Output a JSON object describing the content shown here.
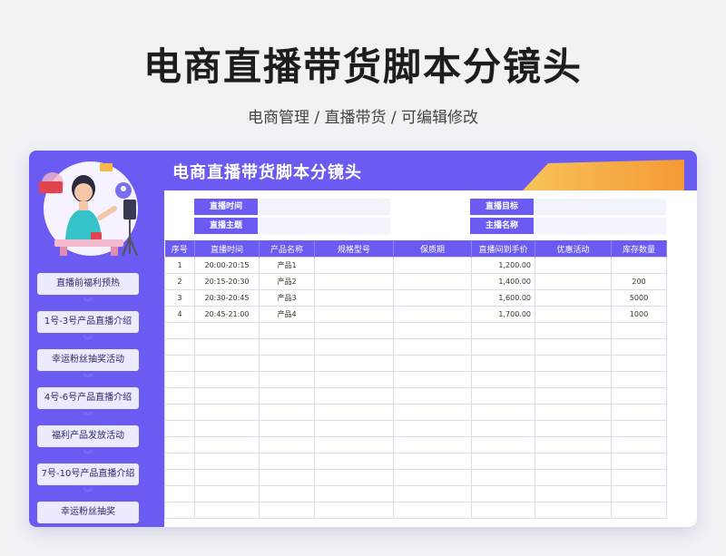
{
  "header": {
    "title": "电商直播带货脚本分镜头",
    "subtitle": "电商管理 / 直播带货 /  可编辑修改"
  },
  "card": {
    "title": "电商直播带货脚本分镜头"
  },
  "info": {
    "live_time_label": "直播时间",
    "live_time_value": "",
    "live_theme_label": "直播主题",
    "live_theme_value": "",
    "live_goal_label": "直播目标",
    "live_goal_value": "",
    "host_name_label": "主播名称",
    "host_name_value": ""
  },
  "sidebar": {
    "items": [
      {
        "label": "直播前福利预热"
      },
      {
        "label": "1号-3号产品直播介绍"
      },
      {
        "label": "幸运粉丝抽奖活动"
      },
      {
        "label": "4号-6号产品直播介绍"
      },
      {
        "label": "福利产品发放活动"
      },
      {
        "label": "7号-10号产品直播介绍"
      },
      {
        "label": "幸运粉丝抽奖"
      }
    ]
  },
  "table": {
    "columns": [
      "序号",
      "直播时间",
      "产品名称",
      "规格型号",
      "保质期",
      "直播间到手价",
      "优惠活动",
      "库存数量"
    ],
    "rows": [
      [
        "1",
        "20:00-20:15",
        "产品1",
        "",
        "",
        "1,200.00",
        "",
        ""
      ],
      [
        "2",
        "20:15-20:30",
        "产品2",
        "",
        "",
        "1,400.00",
        "",
        "200"
      ],
      [
        "3",
        "20:30-20:45",
        "产品3",
        "",
        "",
        "1,600.00",
        "",
        "5000"
      ],
      [
        "4",
        "20:45-21:00",
        "产品4",
        "",
        "",
        "1,700.00",
        "",
        "1000"
      ],
      [
        "",
        "",
        "",
        "",
        "",
        "",
        "",
        ""
      ],
      [
        "",
        "",
        "",
        "",
        "",
        "",
        "",
        ""
      ],
      [
        "",
        "",
        "",
        "",
        "",
        "",
        "",
        ""
      ],
      [
        "",
        "",
        "",
        "",
        "",
        "",
        "",
        ""
      ],
      [
        "",
        "",
        "",
        "",
        "",
        "",
        "",
        ""
      ],
      [
        "",
        "",
        "",
        "",
        "",
        "",
        "",
        ""
      ],
      [
        "",
        "",
        "",
        "",
        "",
        "",
        "",
        ""
      ],
      [
        "",
        "",
        "",
        "",
        "",
        "",
        "",
        ""
      ],
      [
        "",
        "",
        "",
        "",
        "",
        "",
        "",
        ""
      ],
      [
        "",
        "",
        "",
        "",
        "",
        "",
        "",
        ""
      ],
      [
        "",
        "",
        "",
        "",
        "",
        "",
        "",
        ""
      ],
      [
        "",
        "",
        "",
        "",
        "",
        "",
        "",
        ""
      ]
    ]
  },
  "colors": {
    "accent": "#6b5bf2",
    "accent_light": "#eceaff",
    "orange": "#f7a23a"
  },
  "icons": {
    "illustration": "live-host-illustration",
    "arrow": "chevron-down-icon"
  }
}
